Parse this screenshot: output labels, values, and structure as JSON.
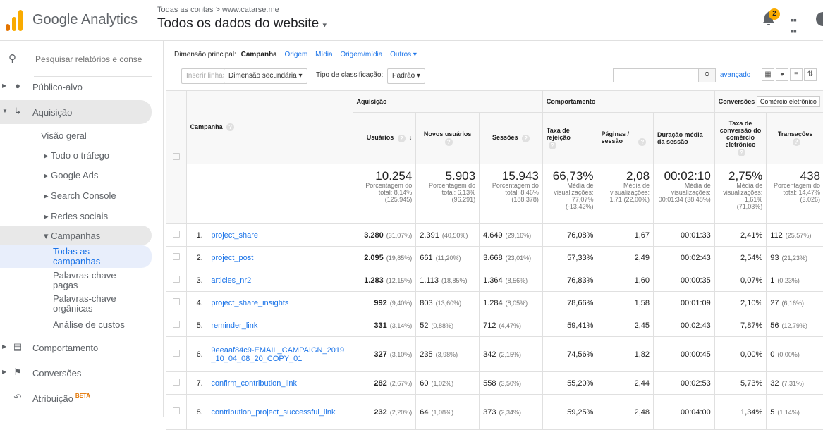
{
  "header": {
    "brand": "Google Analytics",
    "breadcrumb": "Todas as contas > www.catarse.me",
    "view": "Todos os dados do website",
    "notifications": "2"
  },
  "sidebar": {
    "search_placeholder": "Pesquisar relatórios e conse",
    "items": [
      {
        "label": "Público-alvo",
        "icon": "person-icon"
      },
      {
        "label": "Aquisição",
        "icon": "acquisition-icon"
      },
      {
        "label": "Comportamento",
        "icon": "behavior-icon"
      },
      {
        "label": "Conversões",
        "icon": "flag-icon"
      },
      {
        "label": "Atribuição",
        "icon": "attribution-icon",
        "badge": "BETA"
      }
    ],
    "acq_sub": [
      "Visão geral",
      "Todo o tráfego",
      "Google Ads",
      "Search Console",
      "Redes sociais",
      "Campanhas"
    ],
    "camp_sub": [
      "Todas as campanhas",
      "Palavras-chave pagas",
      "Palavras-chave orgânicas",
      "Análise de custos"
    ]
  },
  "dimensions": {
    "label": "Dimensão principal:",
    "selected": "Campanha",
    "others": [
      "Origem",
      "Mídia",
      "Origem/mídia",
      "Outros"
    ]
  },
  "toolbar": {
    "insert_rows": "Inserir linhas",
    "secondary_dim": "Dimensão secundária",
    "sort_label": "Tipo de classificação:",
    "sort_value": "Padrão",
    "advanced": "avançado"
  },
  "table": {
    "group_acq": "Aquisição",
    "group_beh": "Comportamento",
    "group_conv": "Conversões",
    "conv_select": "Comércio eletrônico",
    "col_campaign": "Campanha",
    "columns": [
      "Usuários",
      "Novos usuários",
      "Sessões",
      "Taxa de rejeição",
      "Páginas / sessão",
      "Duração média da sessão",
      "Taxa de conversão do comércio eletrônico",
      "Transações"
    ],
    "totals": [
      {
        "v": "10.254",
        "d": "Porcentagem do total: 8,14% (125.945)"
      },
      {
        "v": "5.903",
        "d": "Porcentagem do total: 6,13% (96.291)"
      },
      {
        "v": "15.943",
        "d": "Porcentagem do total: 8,46% (188.378)"
      },
      {
        "v": "66,73%",
        "d": "Média de visualizações: 77,07% (-13,42%)"
      },
      {
        "v": "2,08",
        "d": "Média de visualizações: 1,71 (22,00%)"
      },
      {
        "v": "00:02:10",
        "d": "Média de visualizações: 00:01:34 (38,48%)"
      },
      {
        "v": "2,75%",
        "d": "Média de visualizações: 1,61% (71,03%)"
      },
      {
        "v": "438",
        "d": "Porcentagem do total: 14,47% (3.026)"
      }
    ],
    "rows": [
      {
        "n": "1.",
        "c": "project_share",
        "u": "3.280",
        "up": "(31,07%)",
        "nu": "2.391",
        "nup": "(40,50%)",
        "s": "4.649",
        "sp": "(29,16%)",
        "r": "76,08%",
        "p": "1,67",
        "d": "00:01:33",
        "cv": "2,41%",
        "t": "112",
        "tp": "(25,57%)"
      },
      {
        "n": "2.",
        "c": "project_post",
        "u": "2.095",
        "up": "(19,85%)",
        "nu": "661",
        "nup": "(11,20%)",
        "s": "3.668",
        "sp": "(23,01%)",
        "r": "57,33%",
        "p": "2,49",
        "d": "00:02:43",
        "cv": "2,54%",
        "t": "93",
        "tp": "(21,23%)"
      },
      {
        "n": "3.",
        "c": "articles_nr2",
        "u": "1.283",
        "up": "(12,15%)",
        "nu": "1.113",
        "nup": "(18,85%)",
        "s": "1.364",
        "sp": "(8,56%)",
        "r": "76,83%",
        "p": "1,60",
        "d": "00:00:35",
        "cv": "0,07%",
        "t": "1",
        "tp": "(0,23%)"
      },
      {
        "n": "4.",
        "c": "project_share_insights",
        "u": "992",
        "up": "(9,40%)",
        "nu": "803",
        "nup": "(13,60%)",
        "s": "1.284",
        "sp": "(8,05%)",
        "r": "78,66%",
        "p": "1,58",
        "d": "00:01:09",
        "cv": "2,10%",
        "t": "27",
        "tp": "(6,16%)"
      },
      {
        "n": "5.",
        "c": "reminder_link",
        "u": "331",
        "up": "(3,14%)",
        "nu": "52",
        "nup": "(0,88%)",
        "s": "712",
        "sp": "(4,47%)",
        "r": "59,41%",
        "p": "2,45",
        "d": "00:02:43",
        "cv": "7,87%",
        "t": "56",
        "tp": "(12,79%)"
      },
      {
        "n": "6.",
        "c": "9eeaaf84c9-EMAIL_CAMPAIGN_2019_10_04_08_20_COPY_01",
        "u": "327",
        "up": "(3,10%)",
        "nu": "235",
        "nup": "(3,98%)",
        "s": "342",
        "sp": "(2,15%)",
        "r": "74,56%",
        "p": "1,82",
        "d": "00:00:45",
        "cv": "0,00%",
        "t": "0",
        "tp": "(0,00%)"
      },
      {
        "n": "7.",
        "c": "confirm_contribution_link",
        "u": "282",
        "up": "(2,67%)",
        "nu": "60",
        "nup": "(1,02%)",
        "s": "558",
        "sp": "(3,50%)",
        "r": "55,20%",
        "p": "2,44",
        "d": "00:02:53",
        "cv": "5,73%",
        "t": "32",
        "tp": "(7,31%)"
      },
      {
        "n": "8.",
        "c": "contribution_project_successful_link",
        "u": "232",
        "up": "(2,20%)",
        "nu": "64",
        "nup": "(1,08%)",
        "s": "373",
        "sp": "(2,34%)",
        "r": "59,25%",
        "p": "2,48",
        "d": "00:04:00",
        "cv": "1,34%",
        "t": "5",
        "tp": "(1,14%)"
      }
    ]
  }
}
